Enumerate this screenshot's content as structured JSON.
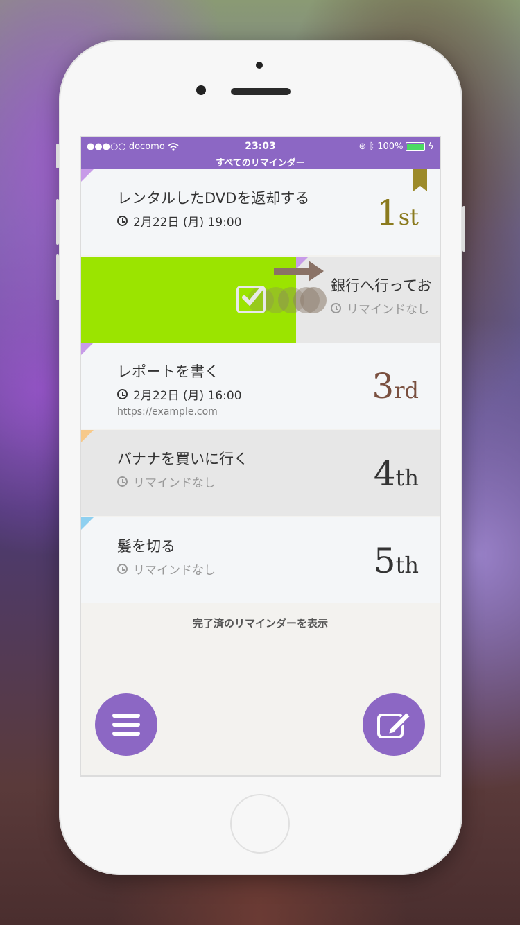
{
  "status_bar": {
    "carrier": "●●●○○ docomo",
    "time": "23:03",
    "battery": "100%",
    "title": "すべてのリマインダー"
  },
  "reminders": [
    {
      "title": "レンタルしたDVDを返却する",
      "meta": "2月22日 (月) 19:00",
      "rank_num": "1",
      "rank_suffix": "st",
      "rank_color": "#8a7a1e",
      "tag_color": "#c79be8"
    },
    {
      "title": "銀行へ行ってお",
      "meta": "リマインドなし",
      "tag_color": "#c79be8"
    },
    {
      "title": "レポートを書く",
      "meta": "2月22日 (月) 16:00",
      "url": "https://example.com",
      "rank_num": "3",
      "rank_suffix": "rd",
      "rank_color": "#7a5040",
      "tag_color": "#c79be8"
    },
    {
      "title": "バナナを買いに行く",
      "meta": "リマインドなし",
      "rank_num": "4",
      "rank_suffix": "th",
      "rank_color": "#333333",
      "tag_color": "#f7c98a"
    },
    {
      "title": "髪を切る",
      "meta": "リマインドなし",
      "rank_num": "5",
      "rank_suffix": "th",
      "rank_color": "#333333",
      "tag_color": "#8fd0f0"
    }
  ],
  "show_completed": "完了済のリマインダーを表示",
  "colors": {
    "accent": "#8c67c4",
    "swipe": "#9be400"
  },
  "icons": {
    "menu": "menu-icon",
    "compose": "compose-icon"
  }
}
